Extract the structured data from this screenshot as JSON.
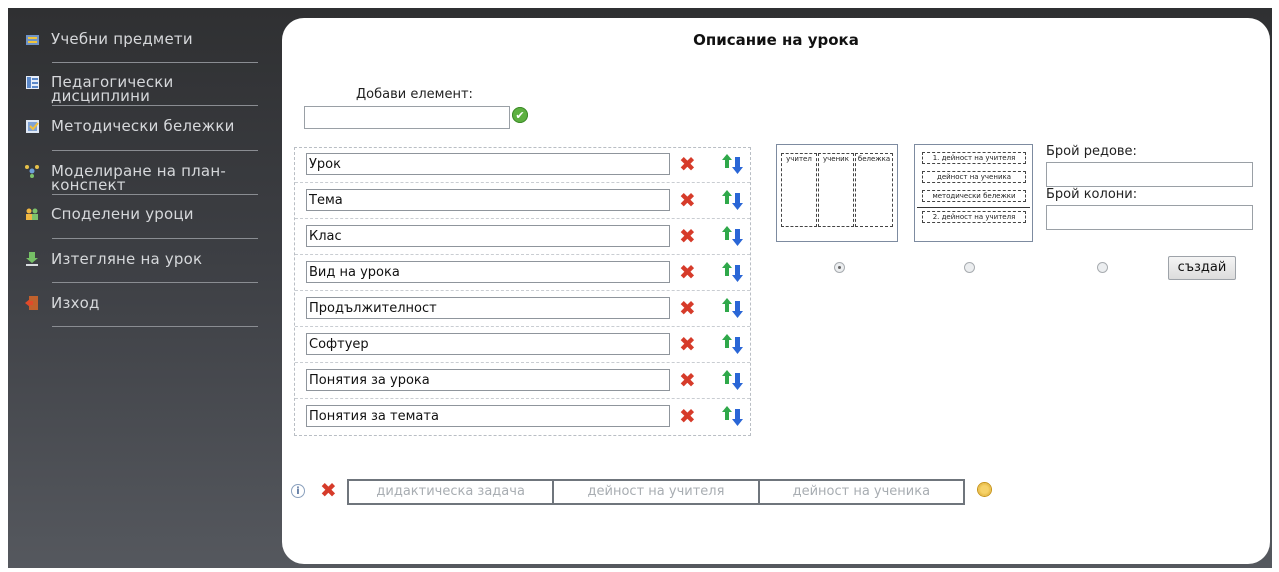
{
  "sidebar": {
    "items": [
      {
        "icon": "books-icon",
        "label": "Учебни предмети"
      },
      {
        "icon": "list-icon",
        "label": "Педагогически дисциплини"
      },
      {
        "icon": "notes-icon",
        "label": "Методически бележки"
      },
      {
        "icon": "network-icon",
        "label": "Моделиране на план-конспект"
      },
      {
        "icon": "share-icon",
        "label": "Споделени уроци"
      },
      {
        "icon": "download-icon",
        "label": "Изтегляне на урок"
      },
      {
        "icon": "exit-icon",
        "label": "Изход"
      }
    ]
  },
  "main": {
    "title": "Описание на урока",
    "add_element_label": "Добави елемент:",
    "add_element_value": "",
    "elements": [
      "Урок",
      "Тема",
      "Клас",
      "Вид на урока",
      "Продължителност",
      "Софтуер",
      "Понятия за урока",
      "Понятия за темата"
    ],
    "layout1": {
      "columns": [
        "учител",
        "ученик",
        "бележка"
      ]
    },
    "layout2": {
      "rows": [
        "1. дейност на учителя",
        "дейност на ученика",
        "методически бележки",
        "2. дейност на учителя"
      ]
    },
    "selected_layout": 1,
    "rows_label": "Брой редове:",
    "cols_label": "Брой колони:",
    "rows_value": "",
    "cols_value": "",
    "create_button": "създай",
    "bottom_cells": [
      "дидактическа задача",
      "дейност на учителя",
      "дейност на ученика"
    ]
  },
  "colors": {
    "accent_red": "#d63b2a",
    "ok_green": "#5cb040",
    "arrow_green": "#2fa84a",
    "arrow_blue": "#2a66d6"
  }
}
